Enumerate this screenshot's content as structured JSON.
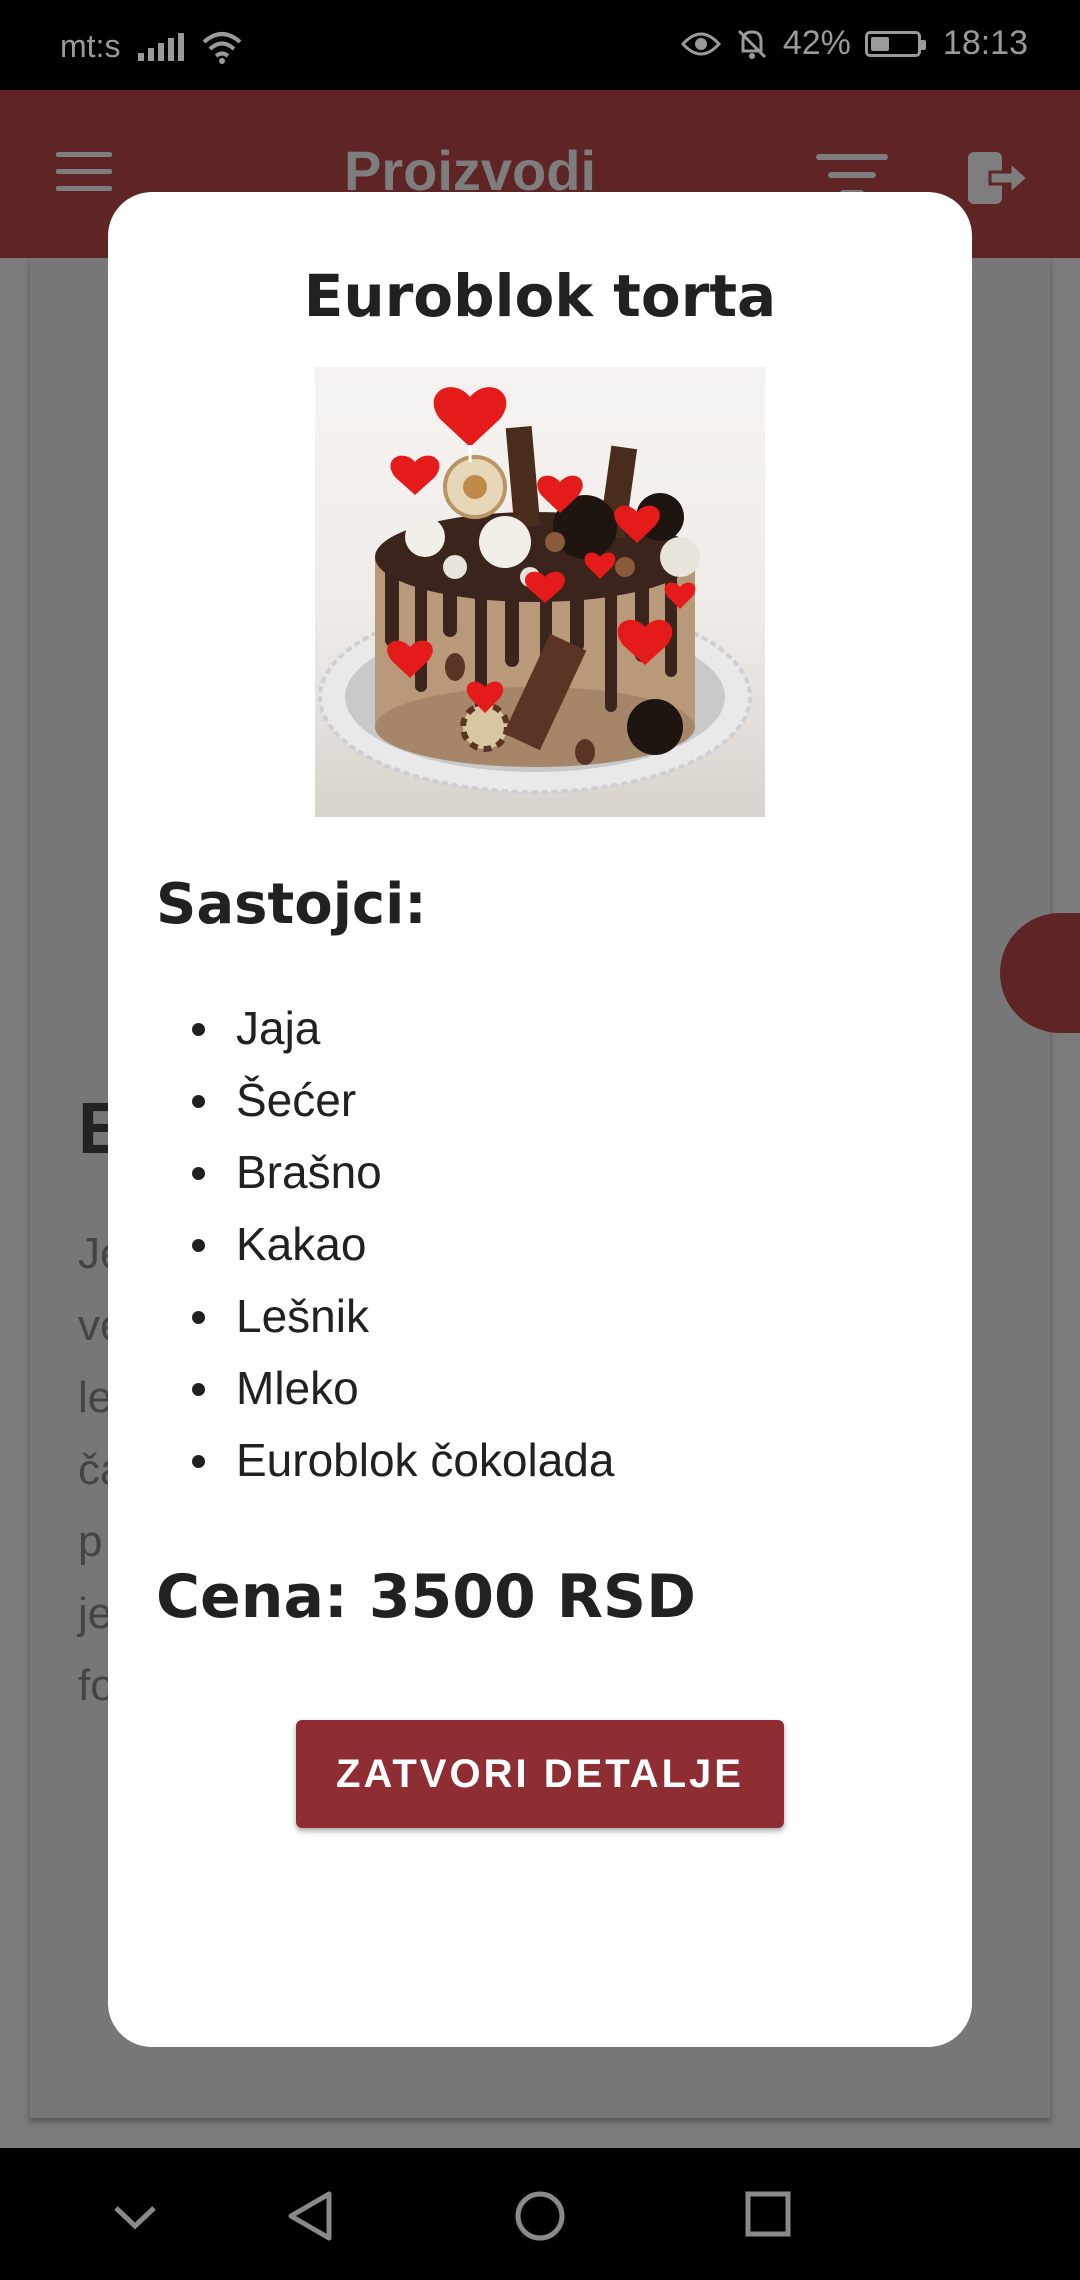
{
  "status_bar": {
    "carrier": "mt:s",
    "battery": "42%",
    "battery_level": 0.42,
    "time": "18:13"
  },
  "app_bar": {
    "title": "Proizvodi",
    "icons": [
      "menu-icon",
      "filter-icon",
      "logout-icon"
    ]
  },
  "modal": {
    "title": "Euroblok torta",
    "image_alt": "cake-image",
    "ingredients_heading": "Sastojci:",
    "ingredients": [
      "Jaja",
      "Šećer",
      "Brašno",
      "Kakao",
      "Lešnik",
      "Mleko",
      "Euroblok čokolada"
    ],
    "price": "Cena: 3500 RSD",
    "close_label": "ZATVORI DETALJE"
  },
  "background": {
    "heading_letter": "E",
    "text_fragments": [
      "Je",
      "ve",
      "le",
      "ča",
      "p",
      "je",
      "fo"
    ]
  },
  "nav_bar": {
    "icons": [
      "collapse-icon",
      "back-icon",
      "home-icon",
      "recents-icon"
    ]
  },
  "colors": {
    "brand": "#8e2e33",
    "overlay": "#7b7b7b"
  }
}
